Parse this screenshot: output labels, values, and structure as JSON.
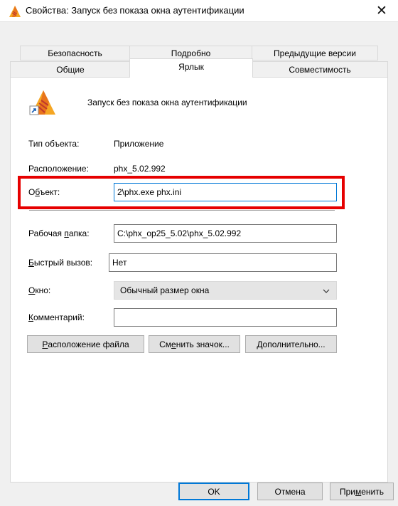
{
  "window": {
    "title": "Свойства: Запуск без показа окна аутентификации",
    "close_glyph": "✕",
    "app_icon": "phx-triangle-icon"
  },
  "tabs": {
    "row1": [
      "Безопасность",
      "Подробно",
      "Предыдущие версии"
    ],
    "row2": [
      "Общие",
      "Ярлык",
      "Совместимость"
    ],
    "active": "Ярлык"
  },
  "shortcut": {
    "icon": "phx-shortcut-icon",
    "name": "Запуск без показа окна аутентификации",
    "type_label": "Тип объекта:",
    "type_value": "Приложение",
    "location_label": "Расположение:",
    "location_value": "phx_5.02.992",
    "target_label_pre": "О",
    "target_label_u": "б",
    "target_label_post": "ъект:",
    "target_value": "2\\phx.exe phx.ini",
    "workdir_label_pre": "Рабочая ",
    "workdir_label_u": "п",
    "workdir_label_post": "апка:",
    "workdir_value": "C:\\phx_op25_5.02\\phx_5.02.992",
    "hotkey_label_pre": "",
    "hotkey_label_u": "Б",
    "hotkey_label_post": "ыстрый вызов:",
    "hotkey_value": "Нет",
    "window_label_pre": "",
    "window_label_u": "О",
    "window_label_post": "кно:",
    "window_value": "Обычный размер окна",
    "comment_label_pre": "",
    "comment_label_u": "К",
    "comment_label_post": "омментарий:",
    "comment_value": ""
  },
  "buttons": {
    "open_location_pre": "",
    "open_location_u": "Р",
    "open_location_post": "асположение файла",
    "change_icon_pre": "См",
    "change_icon_u": "е",
    "change_icon_post": "нить значок...",
    "advanced_pre": "",
    "advanced_u": "Д",
    "advanced_post": "ополнительно..."
  },
  "footer": {
    "ok": "OK",
    "cancel": "Отмена",
    "apply_pre": "При",
    "apply_u": "м",
    "apply_post": "енить"
  },
  "colors": {
    "highlight": "#e60000",
    "accent": "#0078d7"
  }
}
